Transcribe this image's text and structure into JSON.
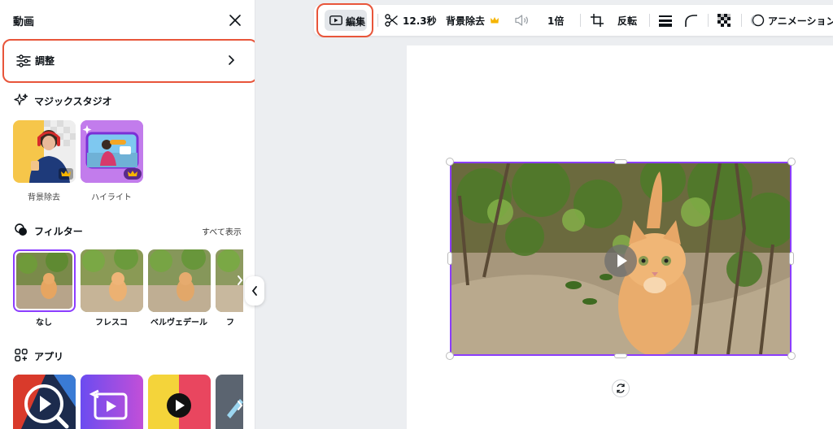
{
  "panel": {
    "title": "動画",
    "adjust_label": "調整",
    "magic_studio": {
      "title": "マジックスタジオ",
      "items": [
        {
          "label": "背景除去",
          "premium": true
        },
        {
          "label": "ハイライト",
          "premium": true
        }
      ]
    },
    "filters": {
      "title": "フィルター",
      "see_all": "すべて表示",
      "items": [
        {
          "label": "なし",
          "selected": true
        },
        {
          "label": "フレスコ"
        },
        {
          "label": "ベルヴェデール"
        },
        {
          "label": "フ"
        }
      ]
    },
    "apps": {
      "title": "アプリ",
      "colors": [
        "#d93a2b",
        "#7b52e8",
        "#f4d43a",
        "#555f6a"
      ]
    }
  },
  "toolbar": {
    "edit_label": "編集",
    "duration": "12.3秒",
    "bg_remove": "背景除去",
    "speed": "1倍",
    "flip": "反転",
    "animation": "アニメーション"
  },
  "colors": {
    "accent": "#8b3dff",
    "highlight": "#e8553a",
    "crown": "#f5b400"
  }
}
